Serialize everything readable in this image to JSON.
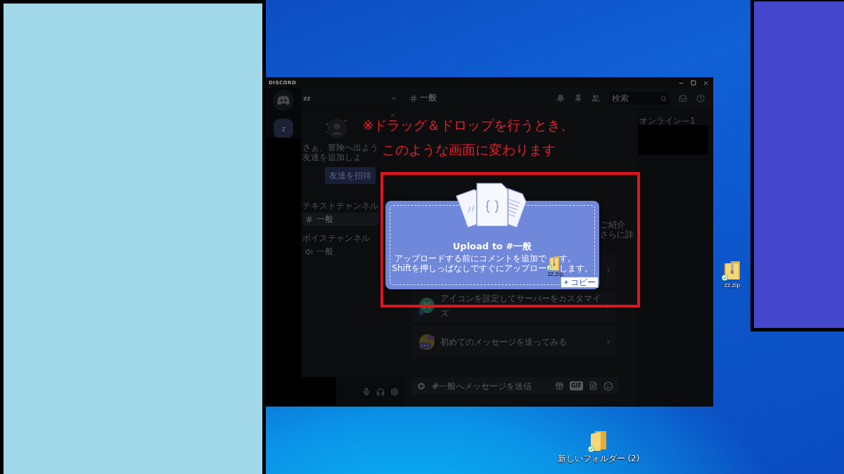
{
  "blank_windows": [
    {
      "color": "#a0d8e8"
    },
    {
      "color": "#4447cc"
    }
  ],
  "discord_window": {
    "title": "DISCORD",
    "server_rail": {
      "servers": [
        {
          "label": "z",
          "selected": true
        }
      ]
    },
    "channel_sidebar": {
      "server_name": "zz",
      "invite": {
        "lines": [
          "さぁ、冒険へ出よう",
          "友達を追加しよ"
        ],
        "button": "友達を招待"
      },
      "categories": [
        {
          "name": "テキストチャンネル",
          "channels": [
            {
              "name": "一般",
              "kind": "text",
              "selected": true
            }
          ]
        },
        {
          "name": "ボイスチャンネル",
          "channels": [
            {
              "name": "一般",
              "kind": "voice",
              "selected": false
            }
          ]
        }
      ]
    },
    "channel_header": {
      "channel": "一般",
      "search": {
        "placeholder": "検索"
      }
    },
    "chat": {
      "intro_fragments": [
        "ご紹介",
        "さらに詳"
      ],
      "tasks": [
        {
          "label": "アイコンを設定してサーバーをカスタマイズ",
          "kind": "customize"
        },
        {
          "label": "初めてのメッセージを送ってみる",
          "kind": "message"
        }
      ],
      "message_input": {
        "placeholder": "#一般へメッセージを送信",
        "gif_button": "GIF"
      }
    },
    "members": {
      "heading": "オンライン—1"
    },
    "upload_overlay": {
      "title": "Upload to #一般",
      "description_lines": [
        {
          "start": "アップロードする前にコメントを追加で",
          "end": "す。"
        },
        {
          "start": "Shiftを押しっぱなしですぐにアップロー",
          "end": "します。"
        }
      ],
      "dragged_file": {
        "label": "zz.zip",
        "action": "コピー"
      }
    }
  },
  "annotation": {
    "lines": [
      "※ドラッグ＆ドロップを行うとき、",
      "このような画面に変わります"
    ]
  },
  "desktop_icons": [
    {
      "label": "zz.zip",
      "kind": "zip"
    },
    {
      "label": "新しいフォルダー (2)",
      "kind": "folder"
    }
  ]
}
